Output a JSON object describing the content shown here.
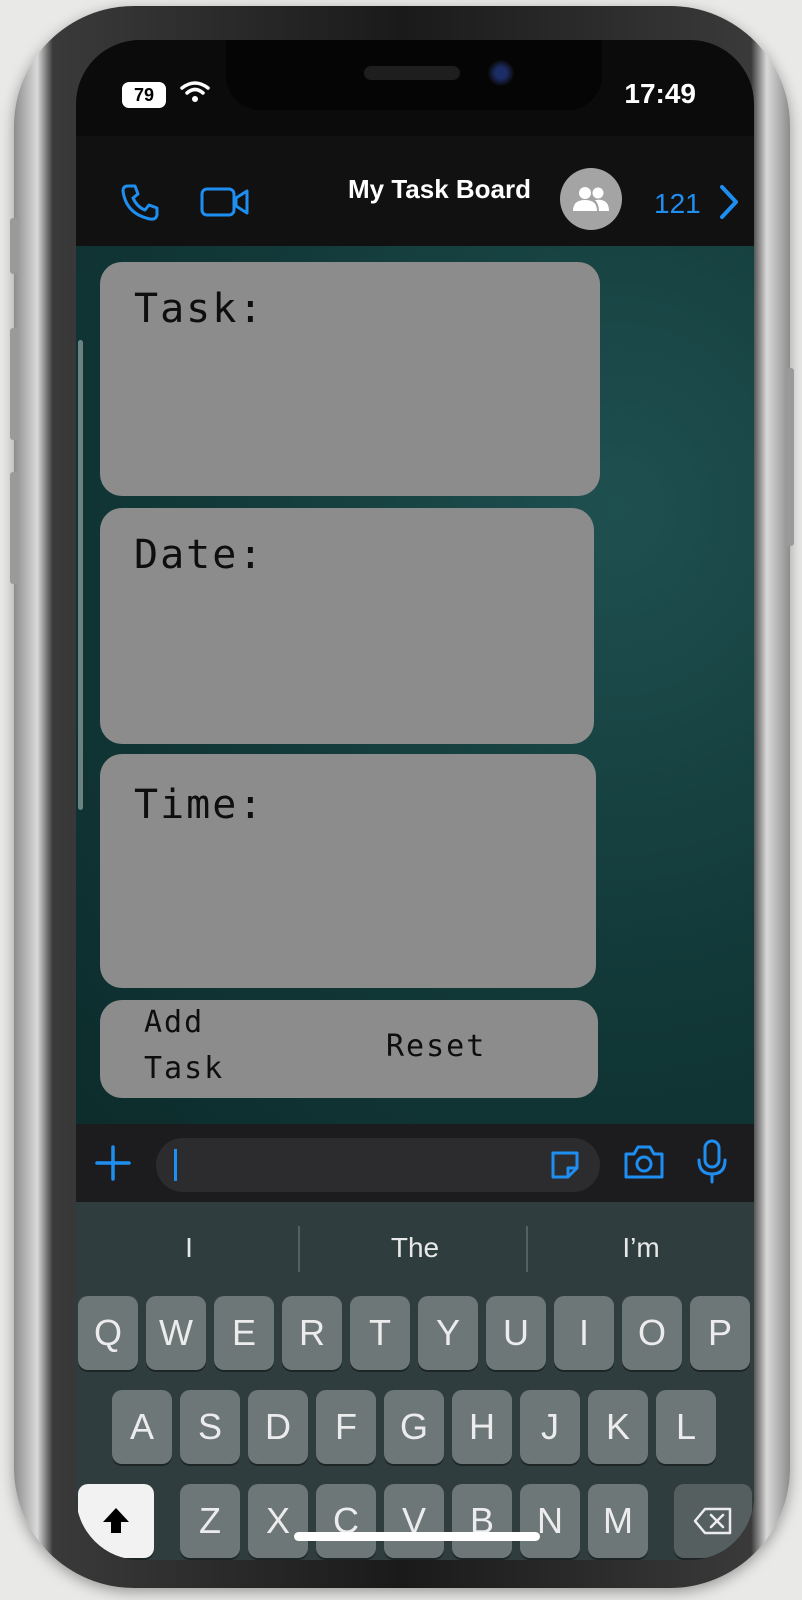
{
  "status_bar": {
    "battery": "79",
    "time": "17:49"
  },
  "header": {
    "title": "My Task Board",
    "member_count": "121"
  },
  "cards": {
    "task_label": "Task:",
    "date_label": "Date:",
    "time_label": "Time:",
    "add_task_line1": "Add",
    "add_task_line2": "Task",
    "reset_label": "Reset"
  },
  "input_bar": {
    "message_value": ""
  },
  "keyboard": {
    "suggestions": [
      "I",
      "The",
      "I’m"
    ],
    "row1": [
      "Q",
      "W",
      "E",
      "R",
      "T",
      "Y",
      "U",
      "I",
      "O",
      "P"
    ],
    "row2": [
      "A",
      "S",
      "D",
      "F",
      "G",
      "H",
      "J",
      "K",
      "L"
    ],
    "row3": [
      "Z",
      "X",
      "C",
      "V",
      "B",
      "N",
      "M"
    ]
  },
  "colors": {
    "accent": "#1f8ef1",
    "card": "#8c8c8c",
    "chat_bg": "#123838"
  }
}
